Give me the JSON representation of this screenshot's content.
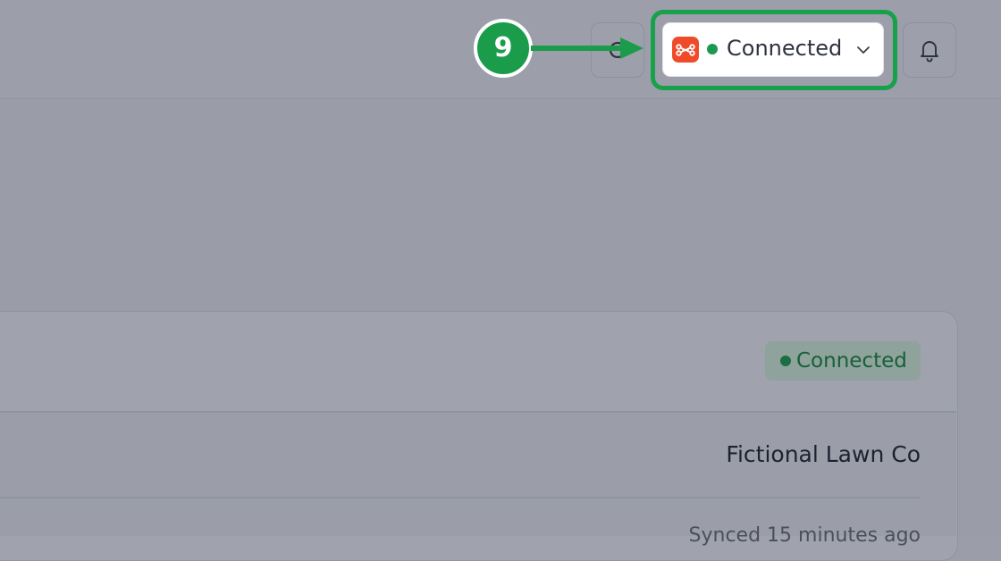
{
  "header": {
    "connection_selector": {
      "app_logo_icon": "link-break-icon",
      "status_label": "Connected",
      "status_color": "#1b9a4f",
      "logo_color": "#ef4b2a"
    },
    "refresh_icon": "refresh-icon",
    "bell_icon": "bell-icon"
  },
  "annotation": {
    "step_number": "9",
    "color": "#1a9c4b"
  },
  "card": {
    "status_badge": "Connected",
    "organization_name": "Fictional Lawn Co",
    "sync_status": "Synced 15 minutes ago"
  }
}
